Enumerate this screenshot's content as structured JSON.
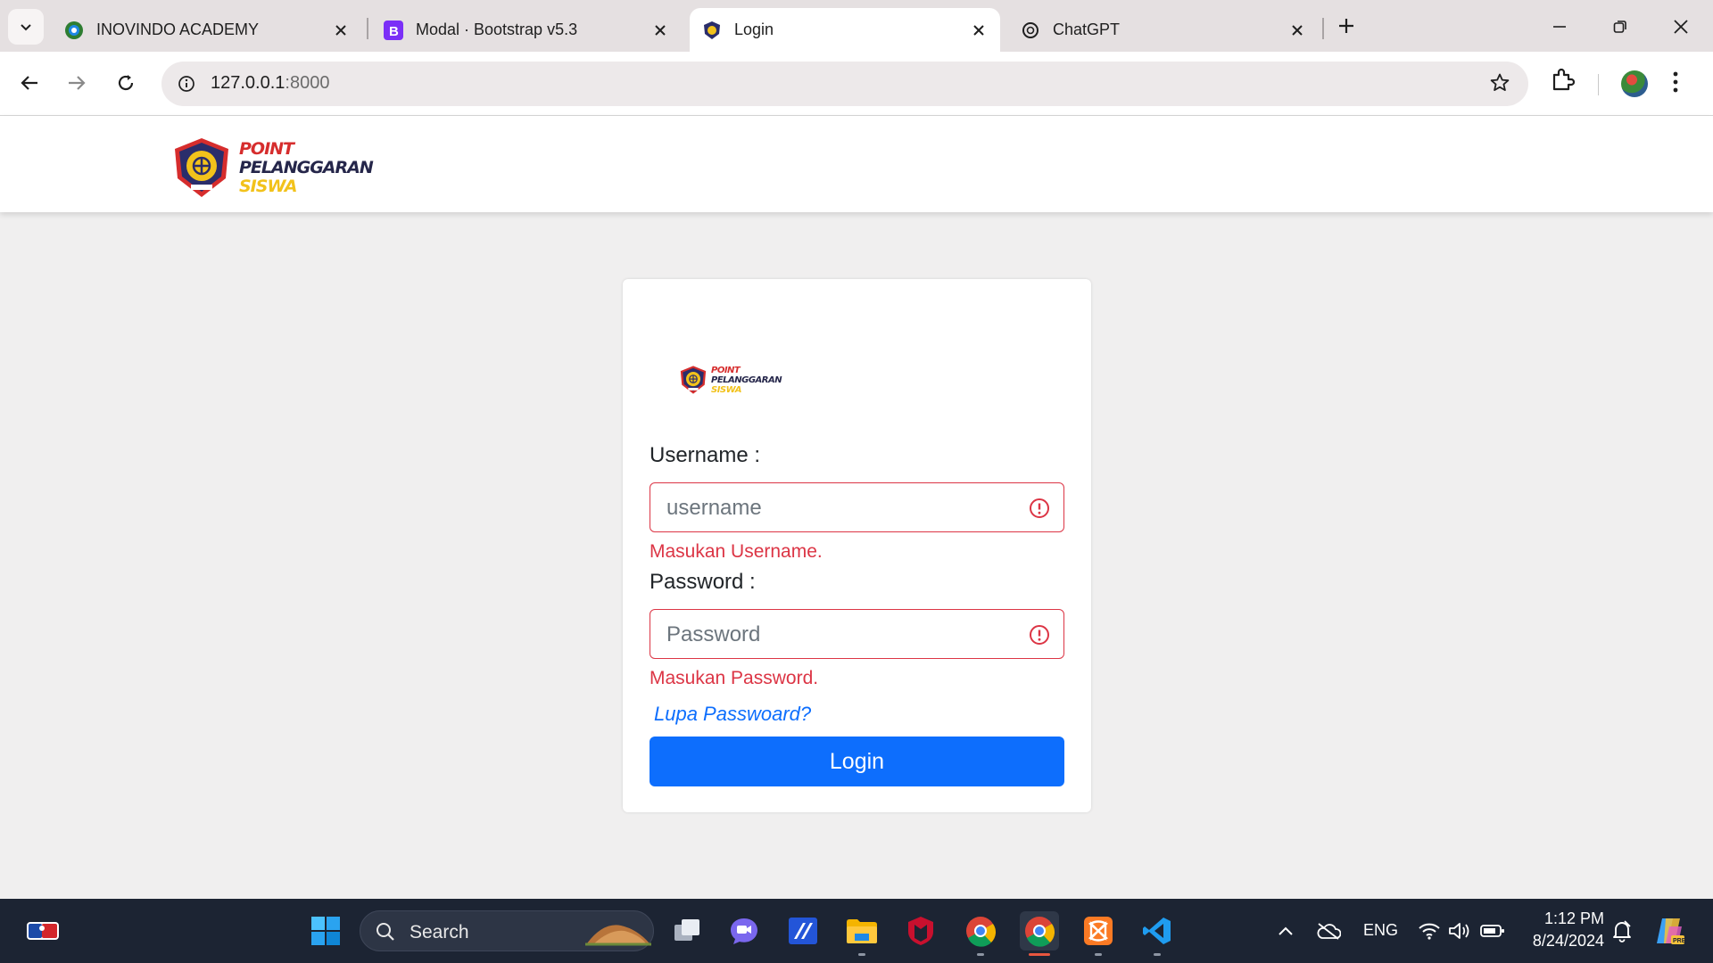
{
  "browser": {
    "tabs": [
      {
        "title": "INOVINDO ACADEMY",
        "icon": "inovindo-favicon"
      },
      {
        "title": "Modal · Bootstrap v5.3",
        "icon": "bootstrap-favicon"
      },
      {
        "title": "Login",
        "icon": "school-logo-favicon",
        "active": true
      },
      {
        "title": "ChatGPT",
        "icon": "openai-favicon"
      }
    ],
    "url_host": "127.0.0.1",
    "url_port": ":8000"
  },
  "header": {
    "logo_line1": "POINT",
    "logo_line2": "PELANGGARAN",
    "logo_line3": "SISWA"
  },
  "login": {
    "username_label": "Username :",
    "username_placeholder": "username",
    "username_error": "Masukan Username.",
    "password_label": "Password :",
    "password_placeholder": "Password",
    "password_error": "Masukan Password.",
    "forgot_link": "Lupa Passwoard?",
    "submit_label": "Login"
  },
  "taskbar": {
    "search_label": "Search",
    "language": "ENG",
    "time": "1:12 PM",
    "date": "8/24/2024"
  },
  "colors": {
    "primary": "#0d6efd",
    "danger": "#dc3545",
    "page_bg": "#f0efef",
    "taskbar_bg": "#1c2433"
  }
}
